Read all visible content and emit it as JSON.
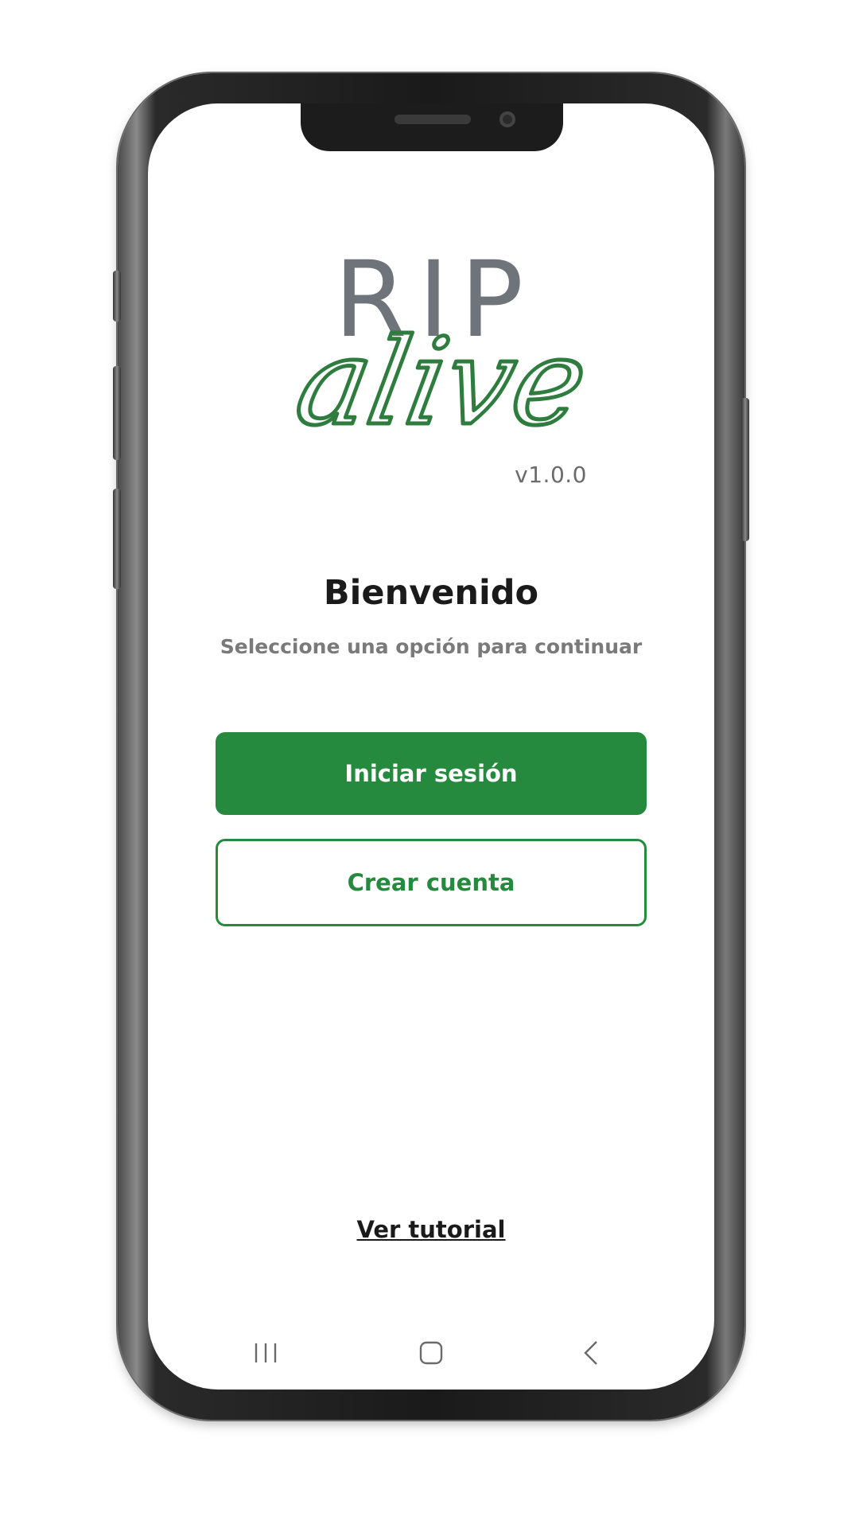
{
  "app": {
    "logo_top": "RIP",
    "logo_script": "alive",
    "version": "v1.0.0"
  },
  "welcome": {
    "title": "Bienvenido",
    "subtitle": "Seleccione una opción para continuar"
  },
  "actions": {
    "login_label": "Iniciar sesión",
    "register_label": "Crear cuenta",
    "tutorial_label": "Ver tutorial"
  },
  "navbar": {
    "items": [
      "recent-apps-icon",
      "home-icon",
      "back-icon"
    ]
  },
  "colors": {
    "brand_green": "#258a3e",
    "logo_gray": "#6f737a",
    "text_dark": "#1a1a1a",
    "text_muted": "#7a7a7a"
  }
}
